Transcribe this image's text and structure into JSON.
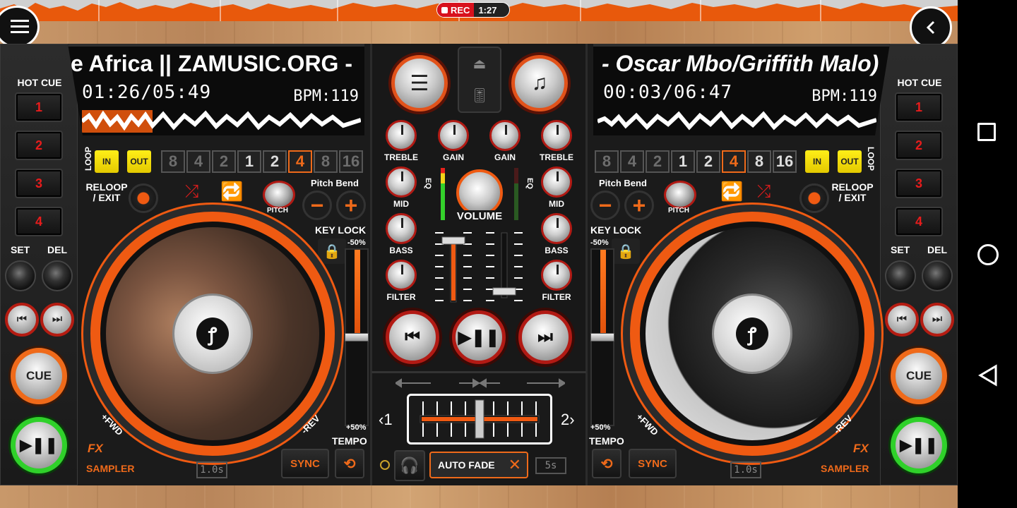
{
  "recording": {
    "rec_label": "REC",
    "elapsed": "1:27"
  },
  "colors": {
    "accent": "#ef6a1a",
    "loop_yellow": "#ffee18",
    "play_green": "#2fd12a",
    "hotcue_red": "#e81c1c"
  },
  "icons": {
    "menu": "hamburger-menu-icon",
    "back": "chevron-left-icon"
  },
  "deck_left": {
    "title": "e Africa || ZAMUSIC.ORG -",
    "time": "01:26/05:49",
    "bpm": "BPM:119",
    "hot_cue_label": "HOT CUE",
    "hot_cues": [
      "1",
      "2",
      "3",
      "4"
    ],
    "set_label": "SET",
    "del_label": "DEL",
    "cue_label": "CUE",
    "loop_label": "LOOP",
    "loop_in": "IN",
    "loop_out": "OUT",
    "beats": [
      "8",
      "4",
      "2",
      "1",
      "2",
      "4",
      "8",
      "16"
    ],
    "active_beat": "4",
    "reloop_label": "RELOOP\n/ EXIT",
    "pitch_label": "PITCH",
    "pitch_bend_label": "Pitch Bend",
    "key_lock_label": "KEY LOCK",
    "pitch_top": "-50%",
    "pitch_bottom": "+50%",
    "fwd_label": "+FWD",
    "rev_label": "-REV",
    "fx_label": "FX",
    "sampler_label": "SAMPLER",
    "sample_len": "1.0s",
    "sync_label": "SYNC",
    "tempo_label": "TEMPO"
  },
  "deck_right": {
    "title": "- Oscar Mbo/Griffith Malo)",
    "time": "00:03/06:47",
    "bpm": "BPM:119",
    "hot_cue_label": "HOT CUE",
    "hot_cues": [
      "1",
      "2",
      "3",
      "4"
    ],
    "set_label": "SET",
    "del_label": "DEL",
    "cue_label": "CUE",
    "loop_label": "LOOP",
    "loop_in": "IN",
    "loop_out": "OUT",
    "beats": [
      "8",
      "4",
      "2",
      "1",
      "2",
      "4",
      "8",
      "16"
    ],
    "active_beat": "4",
    "reloop_label": "RELOOP\n/ EXIT",
    "pitch_label": "PITCH",
    "pitch_bend_label": "Pitch Bend",
    "key_lock_label": "KEY LOCK",
    "pitch_top": "-50%",
    "pitch_bottom": "+50%",
    "fwd_label": "+FWD",
    "rev_label": "-REV",
    "fx_label": "FX",
    "sampler_label": "SAMPLER",
    "sample_len": "1.0s",
    "sync_label": "SYNC",
    "tempo_label": "TEMPO"
  },
  "mixer": {
    "treble": "TREBLE",
    "gain": "GAIN",
    "mid": "MID",
    "bass": "BASS",
    "filter": "FILTER",
    "eq": "EQ",
    "volume": "VOLUME",
    "crossfader_left": "‹1",
    "crossfader_right": "2›",
    "auto_fade": "AUTO FADE",
    "fade_time": "5s"
  }
}
